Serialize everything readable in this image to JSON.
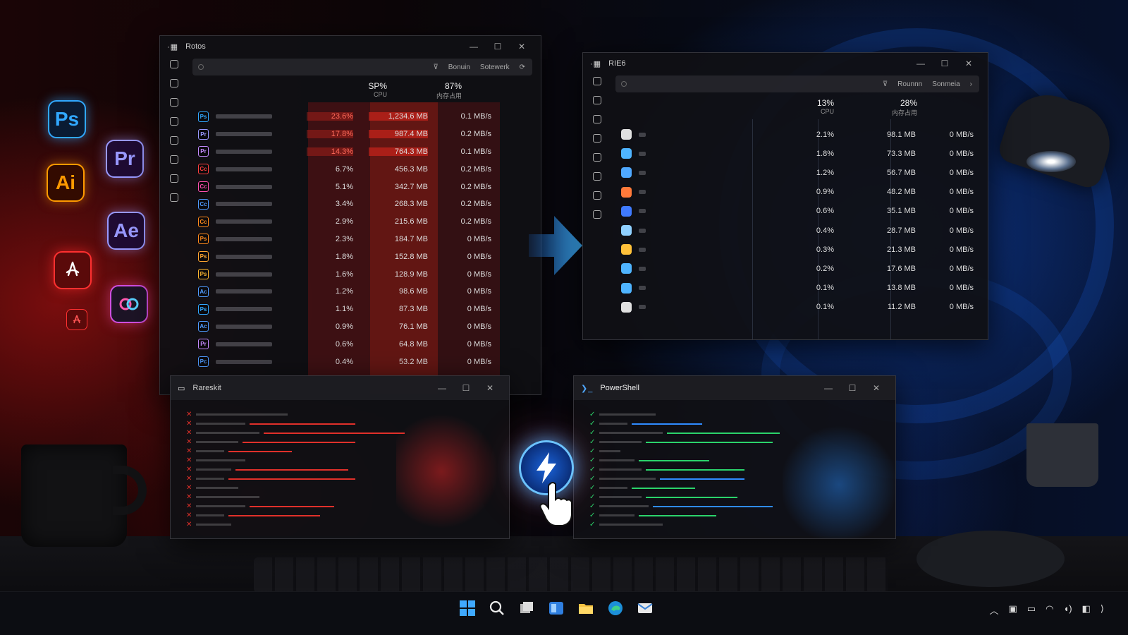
{
  "colors": {
    "accent_red": "#e0302a",
    "accent_blue": "#2f8bff",
    "check_green": "#2bd36b"
  },
  "app_icons": [
    {
      "name": "photoshop-icon",
      "label": "Ps"
    },
    {
      "name": "premiere-icon",
      "label": "Pr"
    },
    {
      "name": "illustrator-icon",
      "label": "Ai"
    },
    {
      "name": "after-effects-icon",
      "label": "Ae"
    },
    {
      "name": "acrobat-icon",
      "label": ""
    },
    {
      "name": "creative-cloud-icon",
      "label": ""
    }
  ],
  "task_manager_left": {
    "title": "Rotos",
    "search_buttons": [
      "Bonuin",
      "Sotewerk"
    ],
    "cpu_header": {
      "value": "SP%",
      "label": "CPU"
    },
    "mem_header": {
      "value": "87%",
      "label": "内存占用"
    },
    "rows": [
      {
        "icon": "Ps",
        "color": "#31a8ff",
        "cpu": "23.6%",
        "mem": "1,234.6 MB",
        "disk": "0.1 MB/s"
      },
      {
        "icon": "Pr",
        "color": "#9999ff",
        "cpu": "17.8%",
        "mem": "987.4 MB",
        "disk": "0.2 MB/s"
      },
      {
        "icon": "Pr",
        "color": "#c58bff",
        "cpu": "14.3%",
        "mem": "764.3 MB",
        "disk": "0.1 MB/s"
      },
      {
        "icon": "Cc",
        "color": "#ff4040",
        "cpu": "6.7%",
        "mem": "456.3 MB",
        "disk": "0.2 MB/s"
      },
      {
        "icon": "Cc",
        "color": "#ff4fb0",
        "cpu": "5.1%",
        "mem": "342.7 MB",
        "disk": "0.2 MB/s"
      },
      {
        "icon": "Cc",
        "color": "#4f9bff",
        "cpu": "3.4%",
        "mem": "268.3 MB",
        "disk": "0.2 MB/s"
      },
      {
        "icon": "Cc",
        "color": "#ff8a1c",
        "cpu": "2.9%",
        "mem": "215.6 MB",
        "disk": "0.2 MB/s"
      },
      {
        "icon": "Ps",
        "color": "#ff8a1c",
        "cpu": "2.3%",
        "mem": "184.7 MB",
        "disk": "0 MB/s"
      },
      {
        "icon": "Ps",
        "color": "#ffa630",
        "cpu": "1.8%",
        "mem": "152.8 MB",
        "disk": "0 MB/s"
      },
      {
        "icon": "Ps",
        "color": "#ffb830",
        "cpu": "1.6%",
        "mem": "128.9 MB",
        "disk": "0 MB/s"
      },
      {
        "icon": "Ac",
        "color": "#4f9bff",
        "cpu": "1.2%",
        "mem": "98.6 MB",
        "disk": "0 MB/s"
      },
      {
        "icon": "Ps",
        "color": "#31a8ff",
        "cpu": "1.1%",
        "mem": "87.3 MB",
        "disk": "0 MB/s"
      },
      {
        "icon": "Ac",
        "color": "#4f9bff",
        "cpu": "0.9%",
        "mem": "76.1 MB",
        "disk": "0 MB/s"
      },
      {
        "icon": "Pr",
        "color": "#c58bff",
        "cpu": "0.6%",
        "mem": "64.8 MB",
        "disk": "0 MB/s"
      },
      {
        "icon": "Pc",
        "color": "#4f9bff",
        "cpu": "0.4%",
        "mem": "53.2 MB",
        "disk": "0 MB/s"
      }
    ]
  },
  "task_manager_right": {
    "title": "RIE6",
    "search_buttons": [
      "Rounnn",
      "Sonmeia"
    ],
    "cpu_header": {
      "value": "13%",
      "label": "CPU"
    },
    "mem_header": {
      "value": "28%",
      "label": "内存占用"
    },
    "rows": [
      {
        "icon": "monitor",
        "color": "#e0e0e0",
        "cpu": "2.1%",
        "mem": "98.1 MB",
        "disk": "0 MB/s"
      },
      {
        "icon": "window",
        "color": "#4fb4ff",
        "cpu": "1.8%",
        "mem": "73.3 MB",
        "disk": "0 MB/s"
      },
      {
        "icon": "folder",
        "color": "#4fa8ff",
        "cpu": "1.2%",
        "mem": "56.7 MB",
        "disk": "0 MB/s"
      },
      {
        "icon": "shield",
        "color": "#ff7a3a",
        "cpu": "0.9%",
        "mem": "48.2 MB",
        "disk": "0 MB/s"
      },
      {
        "icon": "defender",
        "color": "#3f7bff",
        "cpu": "0.6%",
        "mem": "35.1 MB",
        "disk": "0 MB/s"
      },
      {
        "icon": "cloud",
        "color": "#8fd0ff",
        "cpu": "0.4%",
        "mem": "28.7 MB",
        "disk": "0 MB/s"
      },
      {
        "icon": "box",
        "color": "#ffc13a",
        "cpu": "0.3%",
        "mem": "21.3 MB",
        "disk": "0 MB/s"
      },
      {
        "icon": "gear",
        "color": "#4fb4ff",
        "cpu": "0.2%",
        "mem": "17.6 MB",
        "disk": "0 MB/s"
      },
      {
        "icon": "target",
        "color": "#4fb4ff",
        "cpu": "0.1%",
        "mem": "13.8 MB",
        "disk": "0 MB/s"
      },
      {
        "icon": "camera",
        "color": "#e0e0e0",
        "cpu": "0.1%",
        "mem": "11.2 MB",
        "disk": "0 MB/s"
      }
    ]
  },
  "terminal_left": {
    "title": "Rareskit",
    "line_count": 13
  },
  "terminal_right": {
    "title": "PowerShell",
    "line_count": 13
  },
  "taskbar": {
    "icons": [
      "windows-start-icon",
      "search-icon",
      "task-view-icon",
      "widgets-icon",
      "file-explorer-icon",
      "edge-icon",
      "mail-icon"
    ]
  }
}
